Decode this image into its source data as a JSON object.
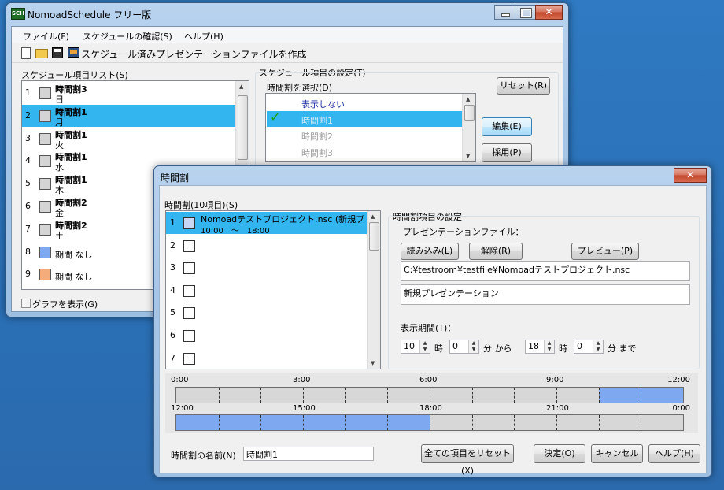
{
  "colors": {
    "accent_blue": "#7ea9f0",
    "selection": "#33b5f0",
    "orange": "#f4ad7a"
  },
  "main_window": {
    "title": "NomoadSchedule フリー版",
    "app_icon": "sch-icon",
    "menu": [
      "ファイル(F)",
      "スケジュールの確認(S)",
      "ヘルプ(H)"
    ],
    "toolbar_label": "スケジュール済みプレゼンテーションファイルを作成",
    "list_label": "スケジュール項目リスト(S)",
    "items": [
      {
        "num": "1",
        "title": "時間割3",
        "sub": "日"
      },
      {
        "num": "2",
        "title": "時間割1",
        "sub": "月"
      },
      {
        "num": "3",
        "title": "時間割1",
        "sub": "火"
      },
      {
        "num": "4",
        "title": "時間割1",
        "sub": "水"
      },
      {
        "num": "5",
        "title": "時間割1",
        "sub": "木"
      },
      {
        "num": "6",
        "title": "時間割2",
        "sub": "金"
      },
      {
        "num": "7",
        "title": "時間割2",
        "sub": "土"
      },
      {
        "num": "8",
        "title": "",
        "sub": "期間 なし"
      },
      {
        "num": "9",
        "title": "",
        "sub": "期間 なし"
      }
    ],
    "graph_checkbox": "グラフを表示(G)",
    "settings_label": "スケジュール項目の設定(T)",
    "select_label": "時間割を選択(D)",
    "reset_button": "リセット(R)",
    "timetable_options": [
      "表示しない",
      "時間割1",
      "時間割2",
      "時間割3"
    ],
    "edit_button": "編集(E)",
    "adopt_button": "採用(P)"
  },
  "dialog": {
    "title": "時間割",
    "list_label": "時間割(10項目)(S)",
    "rows": [
      {
        "num": "1",
        "text": "Nomoadテストプロジェクト.nsc (新規プレゼンテーション)",
        "time": "10:00　～　18:00"
      },
      {
        "num": "2"
      },
      {
        "num": "3"
      },
      {
        "num": "4"
      },
      {
        "num": "5"
      },
      {
        "num": "6"
      },
      {
        "num": "7"
      }
    ],
    "settings_label": "時間割項目の設定",
    "file_label": "プレゼンテーションファイル：",
    "load_button": "読み込み(L)",
    "release_button": "解除(R)",
    "preview_button": "プレビュー(P)",
    "file_path": "C:¥testroom¥testfile¥Nomoadテストプロジェクト.nsc",
    "presentation_name": "新規プレゼンテーション",
    "period_label": "表示期間(T)：",
    "start_hour": "10",
    "hour_unit": "時",
    "start_min": "0",
    "min_from": "分 から",
    "end_hour": "18",
    "end_min": "0",
    "min_to": "分 まで",
    "timeline_top": {
      "ticks": [
        "0:00",
        "3:00",
        "6:00",
        "9:00",
        "12:00"
      ],
      "filled_from": 0.8333,
      "filled_to": 1.0
    },
    "timeline_bottom": {
      "ticks": [
        "12:00",
        "15:00",
        "18:00",
        "21:00",
        "0:00"
      ],
      "filled_from": 0.0,
      "filled_to": 0.5
    },
    "name_label": "時間割の名前(N)",
    "name_value": "時間割1",
    "reset_all_button": "全ての項目をリセット(X)",
    "ok_button": "決定(O)",
    "cancel_button": "キャンセル",
    "help_button": "ヘルプ(H)"
  }
}
